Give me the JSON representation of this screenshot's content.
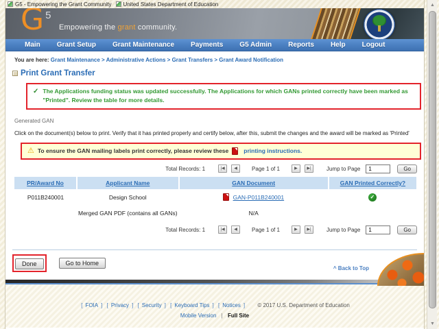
{
  "window": {
    "tabs": [
      {
        "label": "G5 - Empowering the Grant Community"
      },
      {
        "label": "United States Department of Education"
      }
    ]
  },
  "header": {
    "logo_g": "G",
    "logo_5": "5",
    "slogan_prefix": "Empowering the ",
    "slogan_highlight": "grant",
    "slogan_suffix": " community."
  },
  "nav": {
    "items": [
      "Main",
      "Grant Setup",
      "Grant Maintenance",
      "Payments",
      "G5 Admin",
      "Reports",
      "Help",
      "Logout"
    ]
  },
  "breadcrumb": {
    "prefix": "You are here:",
    "path": "Grant Maintenance > Administrative Actions > Grant Transfers > Grant Award Notification"
  },
  "page": {
    "title": "Print Grant Transfer",
    "success_check": "✓",
    "success_message": "The Applications funding status was updated successfully. The Applications for which GANs printed correctly have been marked as \"Printed\". Review the table for more details.",
    "section_label": "Generated GAN",
    "instructions": "Click on the document(s) below to print. Verify that it has printed properly and certify below, after this, submit the changes and the award will be marked as 'Printed'",
    "warning_icon": "⚠",
    "warning_text": "To ensure the GAN mailing labels print correctly, please review these",
    "warning_link": "printing instructions."
  },
  "pagination": {
    "total_records_label": "Total Records: 1",
    "first_icon": "|◀",
    "prev_icon": "◀",
    "page_label": "Page 1 of 1",
    "next_icon": "▶",
    "last_icon": "▶|",
    "jump_label": "Jump to Page",
    "jump_value": "1",
    "go_label": "Go"
  },
  "table": {
    "headers": [
      "PR/Award No",
      "Applicant Name",
      "GAN Document",
      "GAN Printed Correctly?"
    ],
    "rows": [
      {
        "award_no": "P011B240001",
        "applicant": "Design School",
        "gan_doc": "GAN-P011B240001",
        "printed_check": "✓"
      },
      {
        "award_no": "",
        "applicant": "Merged GAN PDF (contains all GANs)",
        "gan_doc": "N/A",
        "printed_check": ""
      }
    ]
  },
  "actions": {
    "done_label": "Done",
    "go_home_label": "Go to Home"
  },
  "back_to_top": "^ Back to Top",
  "footer": {
    "links": [
      "FOIA",
      "Privacy",
      "Security",
      "Keyboard Tips",
      "Notices"
    ],
    "copyright": "©  2017  U.S.  Department  of  Education",
    "mobile_label": "Mobile  Version",
    "separator": "|",
    "full_site_label": "Full  Site"
  },
  "colors": {
    "nav_blue": "#4a7fc1",
    "link_blue": "#2a6cb5",
    "success_green": "#339933",
    "annotation_red": "#e3232b",
    "warning_bg": "#ffffd6",
    "table_header_bg": "#cbdff2",
    "logo_orange": "#ee8f25"
  }
}
